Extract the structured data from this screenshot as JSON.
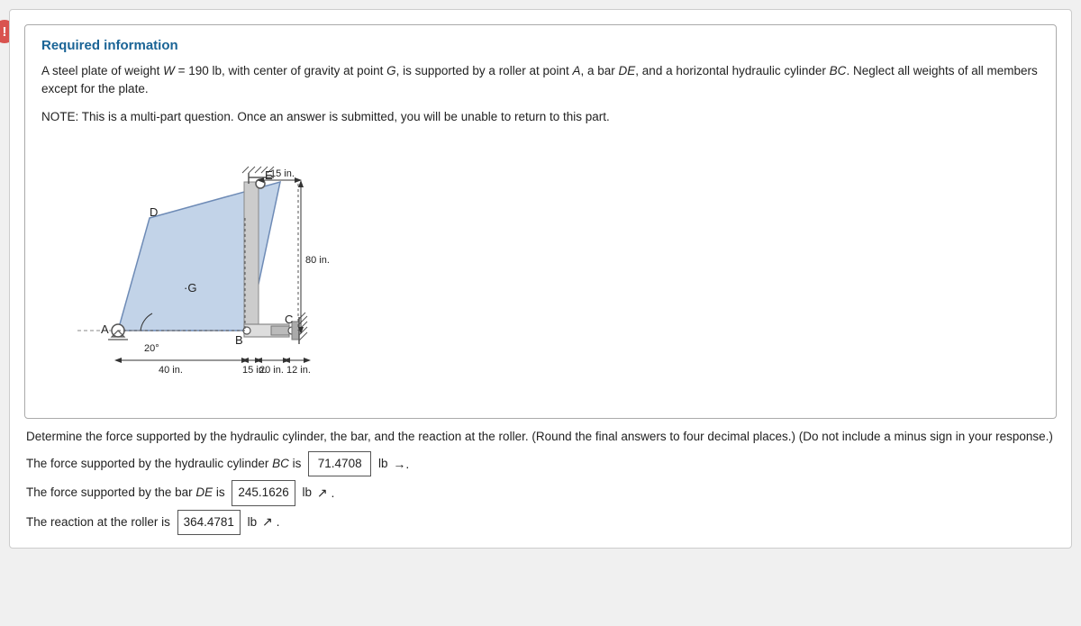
{
  "alert": {
    "icon": "!",
    "color": "#d9534f"
  },
  "info_box": {
    "title": "Required information",
    "description": "A steel plate of weight W = 190 lb, with center of gravity at point G, is supported by a roller at point A, a bar DE, and a horizontal hydraulic cylinder BC. Neglect all weights of all members except for the plate.",
    "note": "NOTE: This is a multi-part question. Once an answer is submitted, you will be unable to return to this part."
  },
  "diagram": {
    "labels": {
      "E": "E",
      "D": "D",
      "G": "G",
      "A": "A",
      "B": "B",
      "C": "C",
      "dim_15in_top": "15 in.",
      "dim_80in": "80 in.",
      "dim_20deg": "20°",
      "dim_40in": "40 in.",
      "dim_15in_bot": "15 in.",
      "dim_20in": "20 in.",
      "dim_12in": "12 in."
    }
  },
  "questions": {
    "intro": "Determine the force supported by the hydraulic cylinder, the bar, and the reaction at the roller. (Round the final answers to four decimal places.) (Do not include a minus sign in your response.)",
    "q1_label": "The force supported by the hydraulic cylinder BC is",
    "q1_value": "71.4708",
    "q1_unit": "lb",
    "q1_direction": "→",
    "q2_label": "The force supported by the bar DE is",
    "q2_value": "245.1626",
    "q2_unit": "lb",
    "q2_direction": "↗",
    "q3_label": "The reaction at the roller is",
    "q3_value": "364.4781",
    "q3_unit": "lb",
    "q3_direction": "↗"
  }
}
